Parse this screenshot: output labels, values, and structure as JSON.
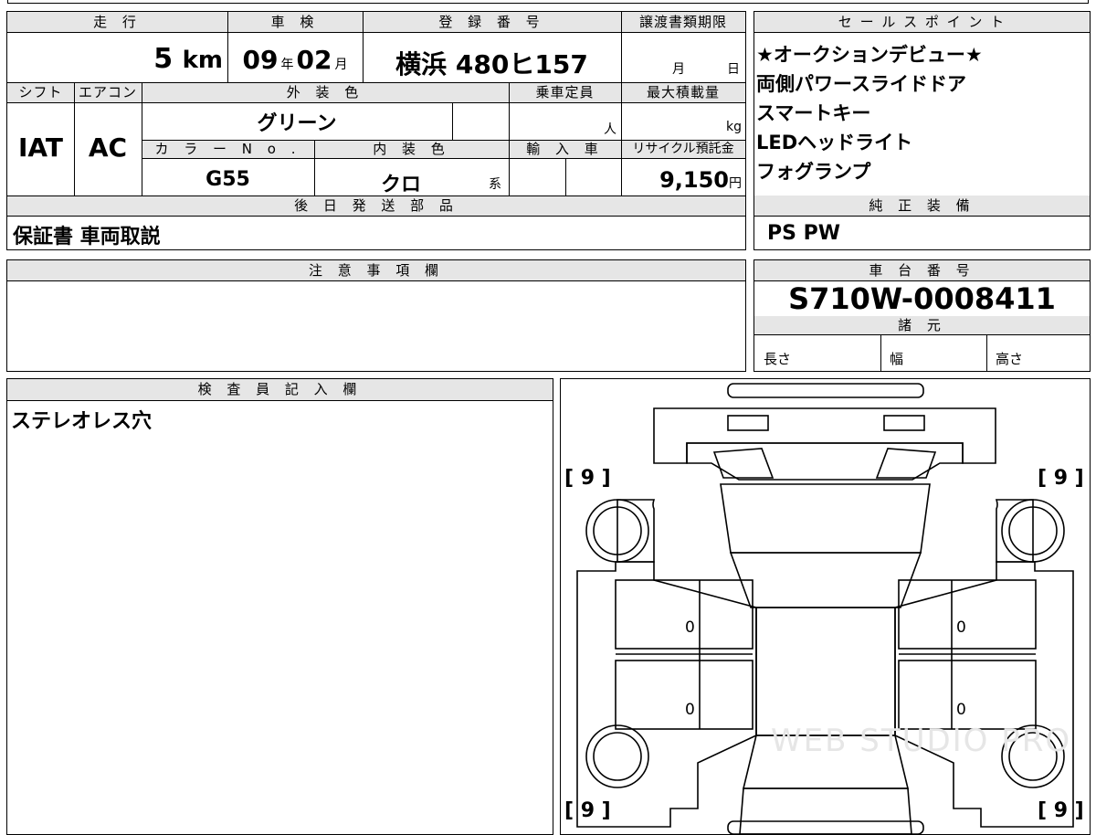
{
  "top_partial": "",
  "headers": {
    "mileage": "走 行",
    "inspection": "車 検",
    "registration": "登 録 番 号",
    "transfer_deadline": "譲渡書類期限",
    "sales_points": "セ ー ル ス ポ イ ン ト",
    "shift": "シフト",
    "aircon": "エアコン",
    "exterior_color": "外 装 色",
    "capacity": "乗車定員",
    "max_load": "最大積載量",
    "color_no": "カ ラ ー N o .",
    "interior_color": "内 装 色",
    "import": "輸 入 車",
    "recycle": "リサイクル預託金",
    "later_parts": "後 日 発 送 部 品",
    "genuine_equipment": "純 正 装 備",
    "notes": "注 意 事 項 欄",
    "chassis_no": "車 台 番 号",
    "specs": "諸 元",
    "inspector": "検 査 員 記 入 欄"
  },
  "values": {
    "mileage": "5",
    "mileage_unit": "km",
    "inspection_year": "09",
    "year_unit": "年",
    "inspection_month": "02",
    "month_unit": "月",
    "registration": "横浜 480ヒ157",
    "transfer_month_unit": "月",
    "transfer_day_unit": "日",
    "shift": "IAT",
    "aircon": "AC",
    "exterior_color": "グリーン",
    "capacity_unit": "人",
    "max_load_unit": "kg",
    "color_no": "G55",
    "interior_color": "クロ",
    "interior_suffix": "系",
    "recycle_fee": "9,150",
    "recycle_unit": "円",
    "later_parts": "保証書 車両取説",
    "genuine_equipment": "PS PW",
    "chassis_no": "S710W-0008411",
    "length_label": "長さ",
    "width_label": "幅",
    "height_label": "高さ",
    "inspector_note": "ステレオレス穴"
  },
  "sales_points": [
    "★オークションデビュー★",
    "両側パワースライドドア",
    "スマートキー",
    "LEDヘッドライト",
    "フォグランプ"
  ],
  "diagram": {
    "tire_tread_fl": "[ 9 ]",
    "tire_tread_fr": "[ 9 ]",
    "tire_tread_rl": "[ 9 ]",
    "tire_tread_rr": "[ 9 ]",
    "door_left_front": "0",
    "door_left_rear": "0",
    "door_right_front": "0",
    "door_right_rear": "0",
    "watermark": "WEB STUDIO PRO"
  }
}
